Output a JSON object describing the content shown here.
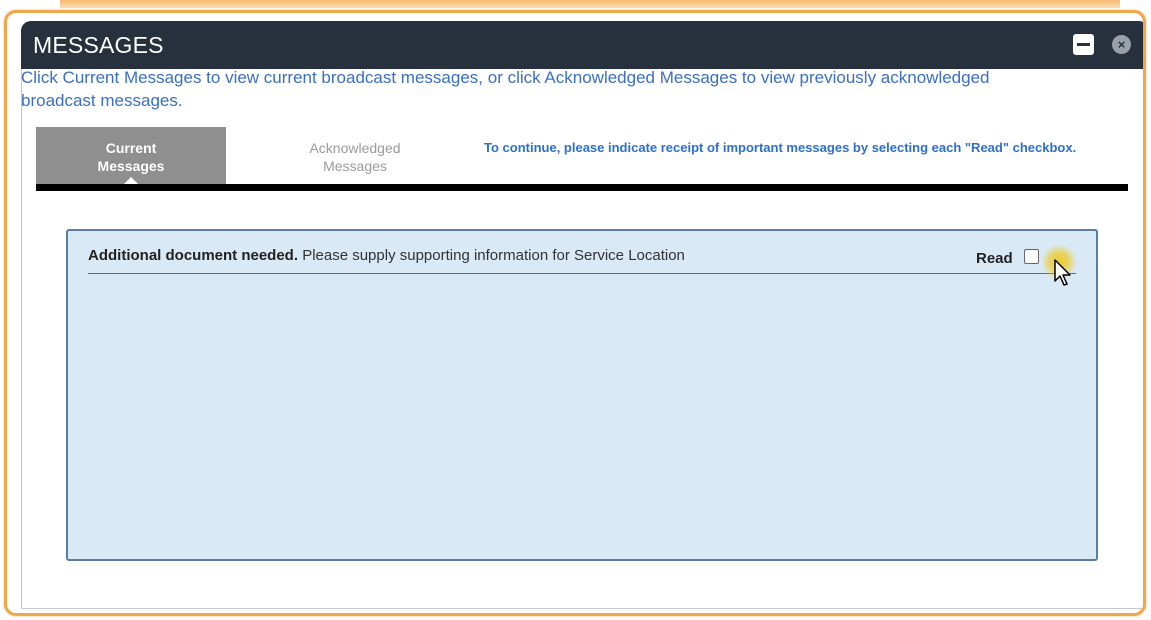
{
  "window": {
    "title": "MESSAGES",
    "minimize_icon": "minimize-icon",
    "close_icon": "close-icon"
  },
  "intro_text": "Click Current Messages to view current broadcast messages, or click Acknowledged Messages to view previously acknowledged broadcast messages.",
  "tabs": [
    {
      "label_line1": "Current",
      "label_line2": "Messages",
      "selected": true
    },
    {
      "label_line1": "Acknowledged",
      "label_line2": "Messages",
      "selected": false
    }
  ],
  "instruction": "To continue, please indicate receipt of important messages by selecting each \"Read\" checkbox.",
  "messages": [
    {
      "title": "Additional document needed.",
      "body": "Please supply supporting information for Service Location",
      "read_label": "Read",
      "read_checked": false
    }
  ],
  "colors": {
    "titlebar": "#27313d",
    "accent_blue": "#3a6fc4",
    "dialog_border": "#f0a64a",
    "panel_bg": "#d9e9f6"
  }
}
